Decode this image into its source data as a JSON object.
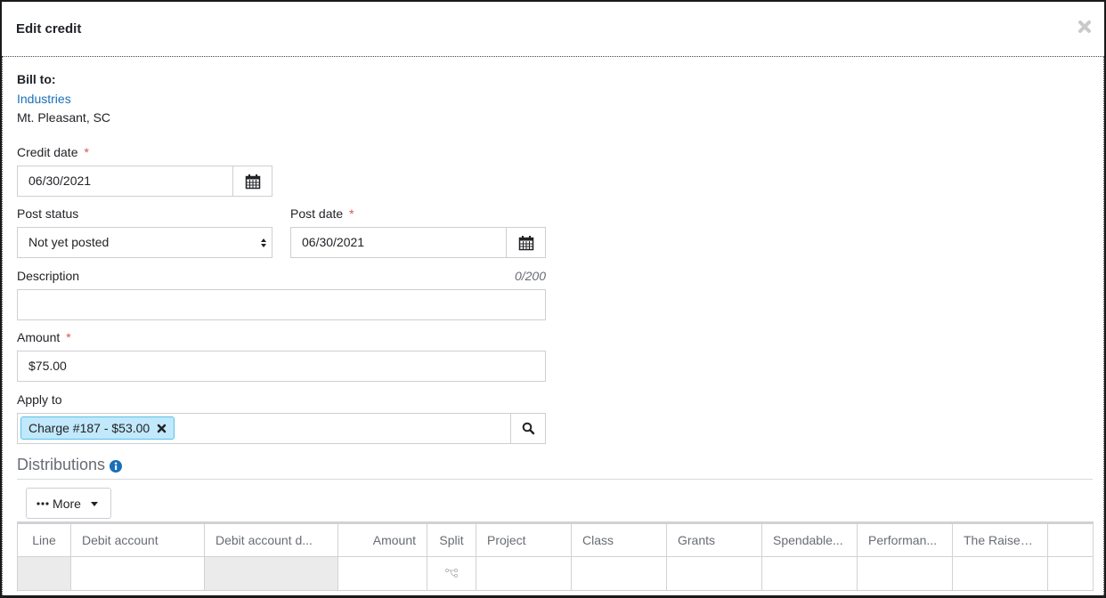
{
  "modal": {
    "title": "Edit credit",
    "close_icon": "close-icon"
  },
  "bill_to": {
    "label": "Bill to:",
    "name": "Industries",
    "location": "Mt. Pleasant, SC"
  },
  "credit_date": {
    "label": "Credit date",
    "required_mark": "*",
    "value": "06/30/2021",
    "icon": "calendar-icon"
  },
  "post_status": {
    "label": "Post status",
    "value": "Not yet posted"
  },
  "post_date": {
    "label": "Post date",
    "required_mark": "*",
    "value": "06/30/2021",
    "icon": "calendar-icon"
  },
  "description": {
    "label": "Description",
    "char_count": "0/200",
    "value": ""
  },
  "amount": {
    "label": "Amount",
    "required_mark": "*",
    "value": "$75.00"
  },
  "apply_to": {
    "label": "Apply to",
    "tags": [
      {
        "label": "Charge #187 - $53.00"
      }
    ],
    "search_icon": "search-icon"
  },
  "distributions": {
    "title": "Distributions",
    "info_icon": "info-icon",
    "more_button": {
      "icon": "ellipsis-icon",
      "label": "More"
    },
    "columns": [
      "Line",
      "Debit account",
      "Debit account d...",
      "Amount",
      "Split",
      "Project",
      "Class",
      "Grants",
      "Spendable...",
      "Performan...",
      "The Raiser'...",
      ""
    ],
    "rows": [
      {
        "line": "",
        "debit_account": "",
        "debit_account_desc": "",
        "amount": "",
        "split_icon": "split-icon",
        "project": "",
        "class": "",
        "grants": "",
        "spendable": "",
        "performance": "",
        "raiser": "",
        "extra": ""
      }
    ]
  },
  "colors": {
    "link": "#1870b8",
    "required": "#d9534f",
    "tag_bg": "#c1e8fb",
    "tag_border": "#56c2e8",
    "info_icon": "#1870b8"
  }
}
